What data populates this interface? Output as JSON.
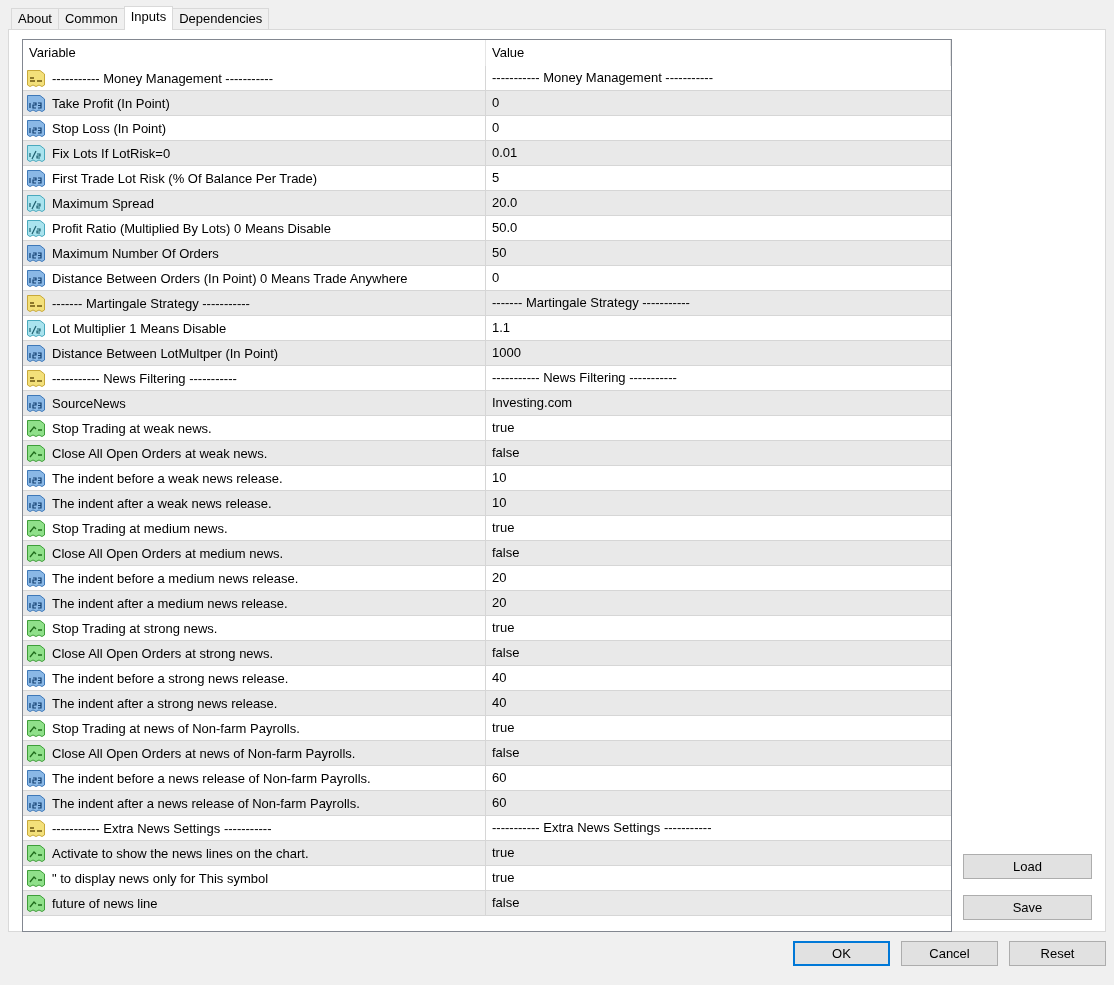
{
  "tabs": [
    {
      "label": "About",
      "selected": false
    },
    {
      "label": "Common",
      "selected": false
    },
    {
      "label": "Inputs",
      "selected": true
    },
    {
      "label": "Dependencies",
      "selected": false
    }
  ],
  "table": {
    "columns": [
      "Variable",
      "Value"
    ],
    "rows": [
      {
        "kind": "string",
        "variable": "----------- Money Management -----------",
        "value": "----------- Money Management -----------"
      },
      {
        "kind": "int",
        "variable": "Take Profit (In Point)",
        "value": "0"
      },
      {
        "kind": "int",
        "variable": "Stop Loss (In Point)",
        "value": "0"
      },
      {
        "kind": "double",
        "variable": "Fix Lots If LotRisk=0",
        "value": "0.01"
      },
      {
        "kind": "int",
        "variable": "First Trade Lot Risk (% Of Balance Per Trade)",
        "value": "5"
      },
      {
        "kind": "double",
        "variable": "Maximum Spread",
        "value": "20.0"
      },
      {
        "kind": "double",
        "variable": "Profit Ratio (Multiplied By Lots) 0 Means Disable",
        "value": "50.0"
      },
      {
        "kind": "int",
        "variable": "Maximum Number Of Orders",
        "value": "50"
      },
      {
        "kind": "int",
        "variable": "Distance Between Orders (In Point) 0 Means Trade Anywhere",
        "value": "0"
      },
      {
        "kind": "string",
        "variable": "------- Martingale Strategy -----------",
        "value": "------- Martingale Strategy -----------"
      },
      {
        "kind": "double",
        "variable": "Lot Multiplier 1 Means Disable",
        "value": "1.1"
      },
      {
        "kind": "int",
        "variable": "Distance Between LotMultper (In Point)",
        "value": "1000"
      },
      {
        "kind": "string",
        "variable": "----------- News Filtering -----------",
        "value": "----------- News Filtering -----------"
      },
      {
        "kind": "int",
        "variable": "SourceNews",
        "value": "Investing.com"
      },
      {
        "kind": "bool",
        "variable": "Stop Trading at weak news.",
        "value": "true"
      },
      {
        "kind": "bool",
        "variable": "Close All Open Orders at weak news.",
        "value": "false"
      },
      {
        "kind": "int",
        "variable": "The indent before a weak news release.",
        "value": "10"
      },
      {
        "kind": "int",
        "variable": "The indent after a weak news release.",
        "value": "10"
      },
      {
        "kind": "bool",
        "variable": "Stop Trading at medium news.",
        "value": "true"
      },
      {
        "kind": "bool",
        "variable": "Close All Open Orders at medium news.",
        "value": "false"
      },
      {
        "kind": "int",
        "variable": "The indent before a medium news release.",
        "value": "20"
      },
      {
        "kind": "int",
        "variable": "The indent after a medium news release.",
        "value": "20"
      },
      {
        "kind": "bool",
        "variable": "Stop Trading at strong news.",
        "value": "true"
      },
      {
        "kind": "bool",
        "variable": "Close All Open Orders at strong news.",
        "value": "false"
      },
      {
        "kind": "int",
        "variable": "The indent before a strong news release.",
        "value": "40"
      },
      {
        "kind": "int",
        "variable": "The indent after a strong news release.",
        "value": "40"
      },
      {
        "kind": "bool",
        "variable": "Stop Trading at news of Non-farm Payrolls.",
        "value": "true"
      },
      {
        "kind": "bool",
        "variable": "Close All Open Orders at news of Non-farm Payrolls.",
        "value": "false"
      },
      {
        "kind": "int",
        "variable": "The indent before a news release of Non-farm Payrolls.",
        "value": "60"
      },
      {
        "kind": "int",
        "variable": "The indent after a news release of Non-farm Payrolls.",
        "value": "60"
      },
      {
        "kind": "string",
        "variable": "----------- Extra News Settings -----------",
        "value": "----------- Extra News Settings -----------"
      },
      {
        "kind": "bool",
        "variable": "Activate to show the news lines on the chart.",
        "value": "true"
      },
      {
        "kind": "bool",
        "variable": "\" to display news only for This symbol",
        "value": "true"
      },
      {
        "kind": "bool",
        "variable": "future of news line",
        "value": "false"
      }
    ]
  },
  "side_buttons": [
    "Load",
    "Save"
  ],
  "footer_buttons": [
    {
      "label": "OK",
      "selected": true
    },
    {
      "label": "Cancel",
      "selected": false
    },
    {
      "label": "Reset",
      "selected": false
    }
  ]
}
